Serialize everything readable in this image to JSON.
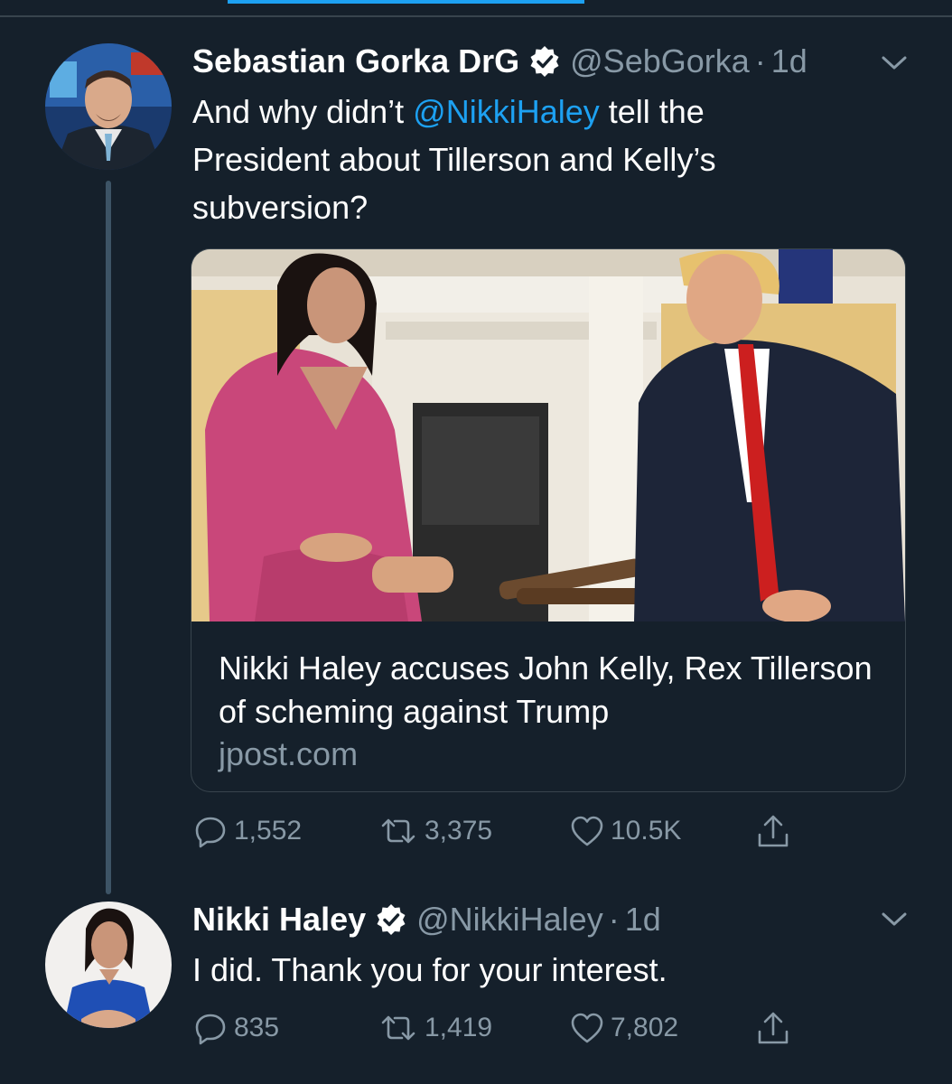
{
  "colors": {
    "background": "#15202b",
    "accent": "#1da1f2",
    "secondary_text": "#8899a6",
    "border": "#38444d"
  },
  "tweets": [
    {
      "display_name": "Sebastian Gorka DrG",
      "verified": true,
      "handle": "@SebGorka",
      "separator": "·",
      "time": "1d",
      "text_line1_before": "And why didn’t ",
      "text_line1_mention": "@NikkiHaley",
      "text_line1_after": " tell the",
      "text_line2": "President about Tillerson and Kelly’s",
      "text_line3": "subversion?",
      "card": {
        "title": "Nikki Haley accuses John Kelly, Rex Tillerson of scheming against Trump",
        "domain": "jpost.com"
      },
      "actions": {
        "replies": "1,552",
        "retweets": "3,375",
        "likes": "10.5K"
      }
    },
    {
      "display_name": "Nikki Haley",
      "verified": true,
      "handle": "@NikkiHaley",
      "separator": "·",
      "time": "1d",
      "text": "I did. Thank you for your interest.",
      "actions": {
        "replies": "835",
        "retweets": "1,419",
        "likes": "7,802"
      }
    }
  ],
  "icons": {
    "verified": "verified-badge-icon",
    "reply": "reply-icon",
    "retweet": "retweet-icon",
    "like": "heart-icon",
    "share": "share-icon",
    "more": "chevron-down-icon"
  }
}
